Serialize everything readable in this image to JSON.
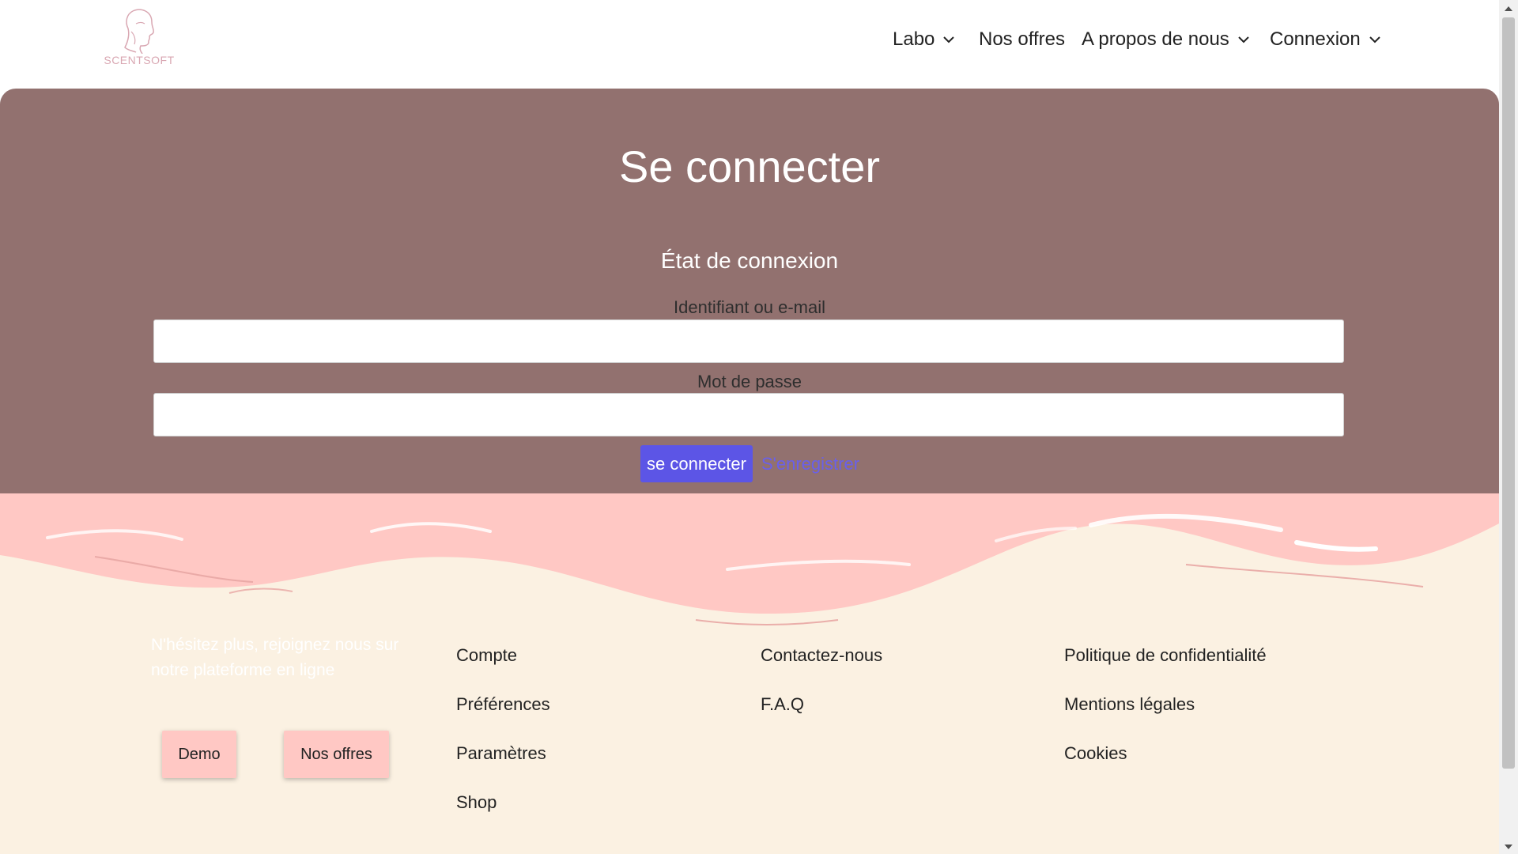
{
  "brand": {
    "name": "SCENTSOFT"
  },
  "nav": {
    "items": [
      {
        "label": "Labo",
        "has_dropdown": true
      },
      {
        "label": "Nos offres",
        "has_dropdown": false
      },
      {
        "label": "A propos de nous",
        "has_dropdown": true
      },
      {
        "label": "Connexion",
        "has_dropdown": true
      }
    ]
  },
  "login": {
    "title": "Se connecter",
    "subtitle": "État de connexion",
    "username_label": "Identifiant ou e-mail",
    "username_value": "",
    "password_label": "Mot de passe",
    "password_value": "",
    "submit_label": "se connecter",
    "register_label": "S'enregistrer"
  },
  "footer": {
    "cta_text": "N'hésitez plus, rejoignez nous sur notre plateforme en ligne",
    "buttons": {
      "demo": "Demo",
      "offres": "Nos offres"
    },
    "col1": [
      "Compte",
      "Préférences",
      "Paramètres",
      "Shop"
    ],
    "col2": [
      "Contactez-nous",
      "F.A.Q"
    ],
    "col3": [
      "Politique de confidentialité",
      "Mentions légales",
      "Cookies"
    ]
  },
  "colors": {
    "panel": "#92716f",
    "wave": "#ffc8c4",
    "footer_bg": "#fbf1e2",
    "primary_button": "#5c55e6",
    "link": "#6a60ea",
    "logo": "#d9a7b2"
  },
  "icons": {
    "nav_dropdown": "chevron-down-icon",
    "logo": "face-profile-logo"
  }
}
